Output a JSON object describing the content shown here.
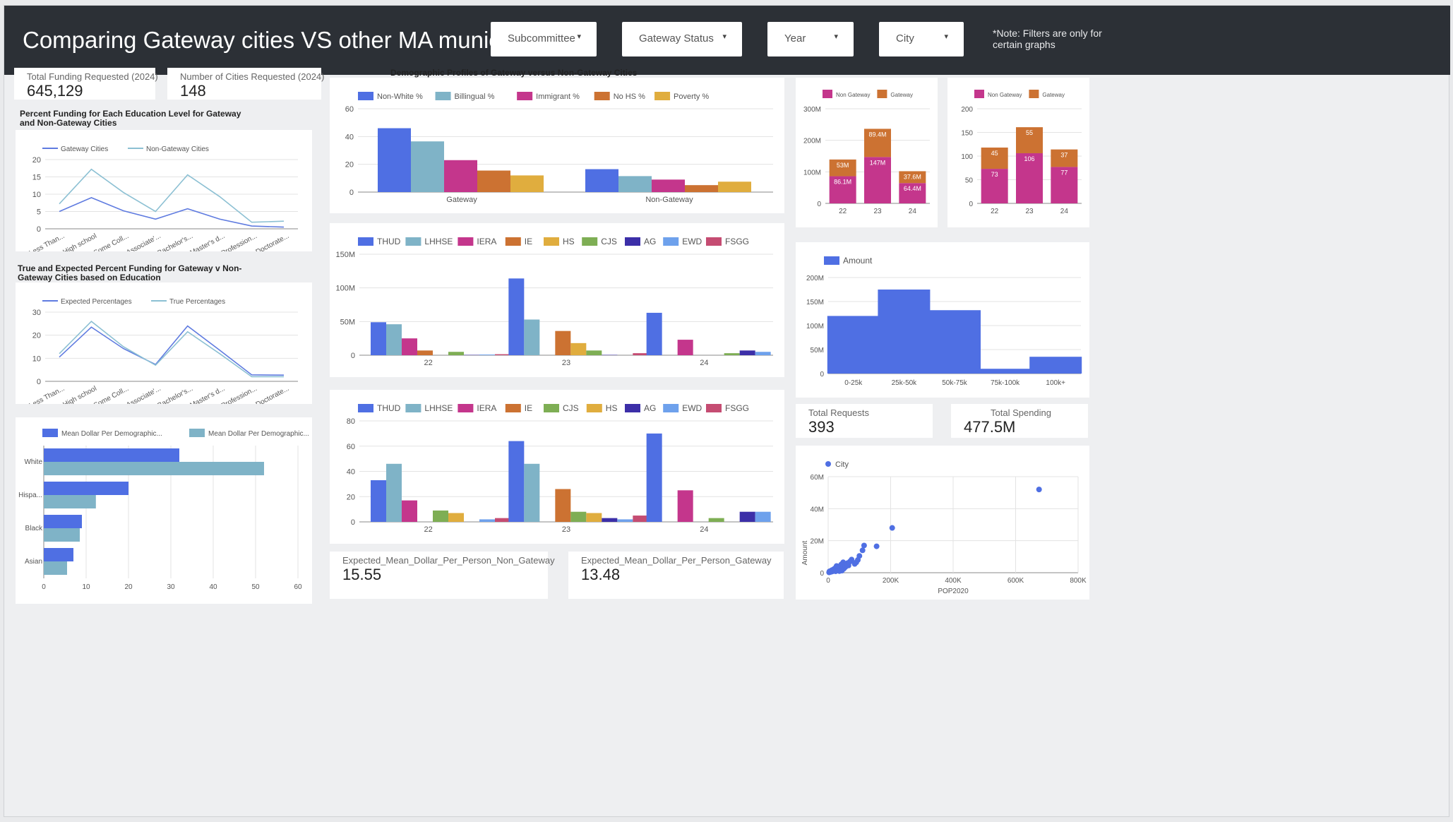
{
  "header": {
    "title": "Comparing Gateway cities VS other MA municipalities",
    "filters": [
      "Subcommittee",
      "Gateway Status",
      "Year",
      "City"
    ],
    "note": "*Note: Filters are only for certain graphs"
  },
  "kpis": {
    "total_funding_label": "Total Funding Requested (2024)",
    "total_funding_value": "645,129",
    "num_cities_label": "Number of Cities Requested (2024)",
    "num_cities_value": "148",
    "total_requests_label": "Total Requests",
    "total_requests_value": "393",
    "total_spending_label": "Total Spending",
    "total_spending_value": "477.5M",
    "exp_non_gateway_label": "Expected_Mean_Dollar_Per_Person_Non_Gateway",
    "exp_non_gateway_value": "15.55",
    "exp_gateway_label": "Expected_Mean_Dollar_Per_Person_Gateway",
    "exp_gateway_value": "13.48"
  },
  "titles": {
    "edu_funding": "Percent Funding for Each Education Level for Gateway and Non-Gateway Cities",
    "true_expected": "True and Expected Percent Funding for Gateway v Non-Gateway Cities based on Education",
    "demographic": "Demographic Profiles of Gateway versus Non-Gateway Cities"
  },
  "colors": {
    "blue": "#4f6fe3",
    "lightblue": "#7fb3c7",
    "magenta": "#c4368c",
    "orange": "#cc7232",
    "gold": "#e0ad3e",
    "green": "#7eae54",
    "navy": "#3c2fa8",
    "skyblue": "#6ea1ec",
    "rose": "#c54c72",
    "line_dark": "#5f7be0",
    "line_light": "#8cc0d3"
  },
  "chart_data": [
    {
      "id": "edu_funding",
      "type": "line",
      "categories": [
        "Less Than...",
        "High school",
        "Some Coll...",
        "Associate'...",
        "Bachelor's...",
        "Master's d...",
        "Profession...",
        "Doctorate..."
      ],
      "ylim": [
        0,
        20
      ],
      "yticks": [
        0,
        5,
        10,
        15,
        20
      ],
      "series": [
        {
          "name": "Gateway Cities",
          "values": [
            5,
            9,
            5.2,
            2.8,
            5.8,
            2.8,
            0.8,
            0.5
          ]
        },
        {
          "name": "Non-Gateway Cities",
          "values": [
            7.2,
            17.2,
            10.5,
            5,
            15.6,
            9.3,
            1.9,
            2.2
          ]
        }
      ]
    },
    {
      "id": "true_expected",
      "type": "line",
      "categories": [
        "Less Than...",
        "High school",
        "Some Coll...",
        "Associate'...",
        "Bachelor's...",
        "Master's d...",
        "Profession...",
        "Doctorate..."
      ],
      "ylim": [
        0,
        30
      ],
      "yticks": [
        0,
        10,
        20,
        30
      ],
      "series": [
        {
          "name": "Expected Percentages",
          "values": [
            10.5,
            23.5,
            14.2,
            7.3,
            24,
            13.5,
            2.8,
            2.7
          ]
        },
        {
          "name": "True Percentages",
          "values": [
            12,
            26,
            15,
            7,
            21.5,
            12,
            2,
            2
          ]
        }
      ]
    },
    {
      "id": "mean_dollar",
      "type": "bar",
      "orientation": "horizontal",
      "categories": [
        "White",
        "Hispa...",
        "Black",
        "Asian"
      ],
      "xlim": [
        0,
        60
      ],
      "xticks": [
        0,
        10,
        20,
        30,
        40,
        50,
        60
      ],
      "series": [
        {
          "name": "Mean Dollar Per Demographic...",
          "values": [
            32,
            20,
            9,
            7
          ]
        },
        {
          "name": "Mean Dollar Per Demographic...",
          "values": [
            52,
            12.3,
            8.5,
            5.5
          ]
        }
      ]
    },
    {
      "id": "demographic",
      "type": "bar",
      "categories": [
        "Gateway",
        "Non-Gateway"
      ],
      "ylim": [
        0,
        60
      ],
      "yticks": [
        0,
        20,
        40,
        60
      ],
      "series": [
        {
          "name": "Non-White %",
          "values": [
            46,
            16.5
          ]
        },
        {
          "name": "Billingual %",
          "values": [
            36.5,
            11.5
          ]
        },
        {
          "name": "Immigrant %",
          "values": [
            23,
            9
          ]
        },
        {
          "name": "No HS %",
          "values": [
            15.5,
            5
          ]
        },
        {
          "name": "Poverty %",
          "values": [
            12,
            7.5
          ]
        }
      ]
    },
    {
      "id": "subcommittee_amount",
      "type": "bar",
      "categories": [
        "22",
        "23",
        "24"
      ],
      "ylim": [
        0,
        150000000
      ],
      "yticks": [
        0,
        50000000,
        100000000,
        150000000
      ],
      "ytick_labels": [
        "0",
        "50M",
        "100M",
        "150M"
      ],
      "series": [
        {
          "name": "THUD",
          "values": [
            49000000,
            114000000,
            63000000
          ]
        },
        {
          "name": "LHHSE",
          "values": [
            46000000,
            53000000,
            0
          ]
        },
        {
          "name": "IERA",
          "values": [
            25000000,
            0,
            23000000
          ]
        },
        {
          "name": "IE",
          "values": [
            7000000,
            36000000,
            0
          ]
        },
        {
          "name": "HS",
          "values": [
            0,
            18000000,
            0
          ]
        },
        {
          "name": "CJS",
          "values": [
            5000000,
            7000000,
            3000000
          ]
        },
        {
          "name": "AG",
          "values": [
            500000,
            500000,
            7000000
          ]
        },
        {
          "name": "EWD",
          "values": [
            1000000,
            0,
            5000000
          ]
        },
        {
          "name": "FSGG",
          "values": [
            1500000,
            3000000,
            0
          ]
        }
      ]
    },
    {
      "id": "subcommittee_count",
      "type": "bar",
      "categories": [
        "22",
        "23",
        "24"
      ],
      "ylim": [
        0,
        80
      ],
      "yticks": [
        0,
        20,
        40,
        60,
        80
      ],
      "series": [
        {
          "name": "THUD",
          "values": [
            33,
            64,
            70
          ]
        },
        {
          "name": "LHHSE",
          "values": [
            46,
            46,
            0
          ]
        },
        {
          "name": "IERA",
          "values": [
            17,
            0,
            25
          ]
        },
        {
          "name": "IE",
          "values": [
            0,
            26,
            0
          ]
        },
        {
          "name": "CJS",
          "values": [
            9,
            8,
            3
          ]
        },
        {
          "name": "HS",
          "values": [
            7,
            7,
            0
          ]
        },
        {
          "name": "AG",
          "values": [
            0,
            3,
            8
          ]
        },
        {
          "name": "EWD",
          "values": [
            2,
            2,
            8
          ]
        },
        {
          "name": "FSGG",
          "values": [
            3,
            5,
            0
          ]
        }
      ]
    },
    {
      "id": "gateway_amount_stacked",
      "type": "bar",
      "stacked": true,
      "categories": [
        "22",
        "23",
        "24"
      ],
      "ylim": [
        0,
        300000000
      ],
      "yticks": [
        0,
        100000000,
        200000000,
        300000000
      ],
      "ytick_labels": [
        "0",
        "100M",
        "200M",
        "300M"
      ],
      "series": [
        {
          "name": "Non Gateway",
          "values": [
            86100000,
            147000000,
            64400000
          ],
          "labels": [
            "86.1M",
            "147M",
            "64.4M"
          ]
        },
        {
          "name": "Gateway",
          "values": [
            53000000,
            89400000,
            37600000
          ],
          "labels": [
            "53M",
            "89.4M",
            "37.6M"
          ]
        }
      ]
    },
    {
      "id": "gateway_count_stacked",
      "type": "bar",
      "stacked": true,
      "categories": [
        "22",
        "23",
        "24"
      ],
      "ylim": [
        0,
        200
      ],
      "yticks": [
        0,
        50,
        100,
        150,
        200
      ],
      "series": [
        {
          "name": "Non Gateway",
          "values": [
            73,
            106,
            77
          ],
          "labels": [
            "73",
            "106",
            "77"
          ]
        },
        {
          "name": "Gateway",
          "values": [
            45,
            55,
            37
          ],
          "labels": [
            "45",
            "55",
            "37"
          ]
        }
      ]
    },
    {
      "id": "amount_by_range",
      "type": "bar",
      "categories": [
        "0-25k",
        "25k-50k",
        "50k-75k",
        "75k-100k",
        "100k+"
      ],
      "ylim": [
        0,
        200000000
      ],
      "yticks": [
        0,
        50000000,
        100000000,
        150000000,
        200000000
      ],
      "ytick_labels": [
        "0",
        "50M",
        "100M",
        "150M",
        "200M"
      ],
      "series": [
        {
          "name": "Amount",
          "values": [
            120000000,
            175000000,
            132000000,
            10000000,
            35000000
          ]
        }
      ]
    },
    {
      "id": "pop_scatter",
      "type": "scatter",
      "xlabel": "POP2020",
      "ylabel": "Amount",
      "xlim": [
        0,
        800000
      ],
      "xticks": [
        0,
        200000,
        400000,
        600000,
        800000
      ],
      "xtick_labels": [
        "0",
        "200K",
        "400K",
        "600K",
        "800K"
      ],
      "ylim": [
        0,
        60000000
      ],
      "yticks": [
        0,
        20000000,
        40000000,
        60000000
      ],
      "ytick_labels": [
        "0",
        "20M",
        "40M",
        "60M"
      ],
      "series": [
        {
          "name": "City",
          "points": [
            [
              675000,
              52000000
            ],
            [
              205000,
              28000000
            ],
            [
              155000,
              16500000
            ],
            [
              115000,
              17000000
            ],
            [
              110000,
              14000000
            ],
            [
              100000,
              10500000
            ],
            [
              95000,
              8000000
            ],
            [
              90000,
              6500000
            ],
            [
              85000,
              5500000
            ],
            [
              75000,
              8200000
            ],
            [
              70000,
              7000000
            ],
            [
              65000,
              4500000
            ],
            [
              62000,
              6000000
            ],
            [
              58000,
              5000000
            ],
            [
              55000,
              3500000
            ],
            [
              52000,
              4800000
            ],
            [
              50000,
              2500000
            ],
            [
              48000,
              6500000
            ],
            [
              45000,
              3800000
            ],
            [
              42000,
              5200000
            ],
            [
              40000,
              2000000
            ],
            [
              38000,
              4200000
            ],
            [
              35000,
              3000000
            ],
            [
              32000,
              1500000
            ],
            [
              30000,
              3500000
            ],
            [
              28000,
              2400000
            ],
            [
              25000,
              1800000
            ],
            [
              22000,
              2800000
            ],
            [
              20000,
              1200000
            ],
            [
              18000,
              2200000
            ],
            [
              15000,
              900000
            ],
            [
              12000,
              1600000
            ],
            [
              10000,
              600000
            ],
            [
              8000,
              1100000
            ],
            [
              6000,
              400000
            ],
            [
              4000,
              800000
            ],
            [
              3000,
              200000
            ],
            [
              24000,
              900000
            ],
            [
              36000,
              1000000
            ],
            [
              44000,
              1300000
            ],
            [
              27000,
              4200000
            ]
          ]
        }
      ]
    }
  ]
}
